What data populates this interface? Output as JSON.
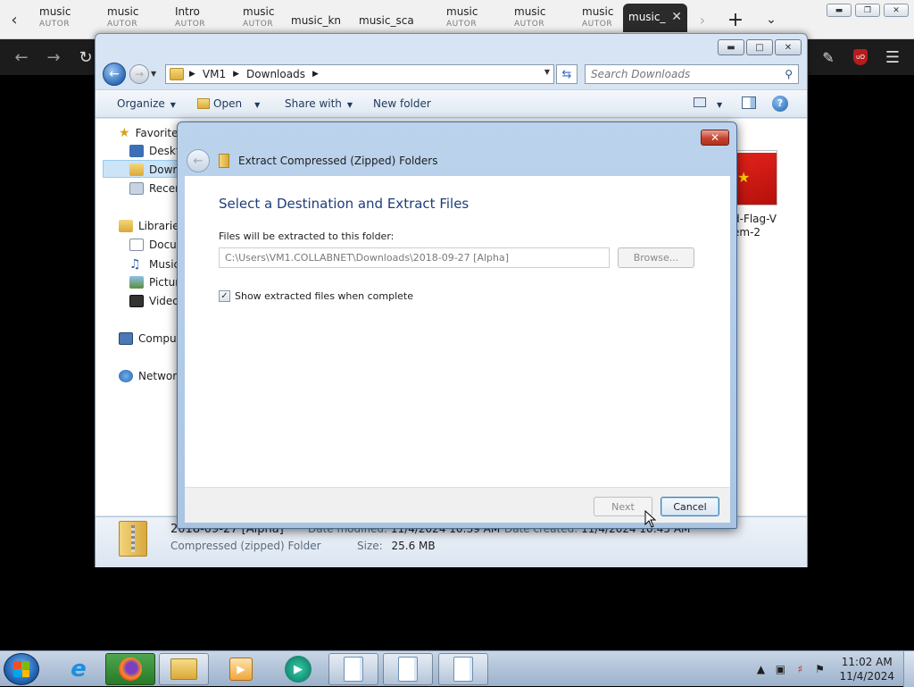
{
  "browser": {
    "tabs": [
      {
        "title": "music",
        "sub": "AUTOR"
      },
      {
        "title": "music",
        "sub": "AUTOR"
      },
      {
        "title": "Intro",
        "sub": "AUTOR"
      },
      {
        "title": "music",
        "sub": "AUTOR"
      },
      {
        "title": "music_kn",
        "sub": ""
      },
      {
        "title": "music_sca",
        "sub": ""
      },
      {
        "title": "music",
        "sub": "AUTOR"
      },
      {
        "title": "music",
        "sub": "AUTOR"
      },
      {
        "title": "music",
        "sub": "AUTOR"
      },
      {
        "title": "music_",
        "sub": ""
      }
    ],
    "active_tab_index": 9
  },
  "explorer": {
    "breadcrumb": [
      "VM1",
      "Downloads"
    ],
    "search_placeholder": "Search Downloads",
    "commands": {
      "organize": "Organize",
      "open": "Open",
      "share_with": "Share with",
      "new_folder": "New folder"
    },
    "nav": {
      "favorites": "Favorites",
      "desktop": "Deskto",
      "downloads": "Downl",
      "recent": "Recen",
      "libraries": "Libraries",
      "documents": "Docun",
      "music": "Music",
      "pictures": "Picture",
      "videos": "Videos",
      "computer": "Comput",
      "network": "Network"
    },
    "file_thumb": {
      "label_line1": "d-Flag-V",
      "label_line2": "em-2"
    },
    "details": {
      "name": "2018-09-27 [Alpha]",
      "type": "Compressed (zipped) Folder",
      "modified_label": "Date modified:",
      "modified_value": "11/4/2024 10:39 AM",
      "created_label": "Date created:",
      "created_value": "11/4/2024 10:45 AM",
      "size_label": "Size:",
      "size_value": "25.6 MB"
    }
  },
  "dialog": {
    "title": "Extract Compressed (Zipped) Folders",
    "heading": "Select a Destination and Extract Files",
    "folder_label": "Files will be extracted to this folder:",
    "path": "C:\\Users\\VM1.COLLABNET\\Downloads\\2018-09-27 [Alpha]",
    "browse": "Browse...",
    "show_checkbox_checked": true,
    "show_label": "Show extracted files when complete",
    "next": "Next",
    "cancel": "Cancel"
  },
  "taskbar": {
    "clock_time": "11:02 AM",
    "clock_date": "11/4/2024"
  },
  "colors": {
    "dialog_heading": "#1e3d7a",
    "taskbar_active": "#277a27",
    "close_red": "#c4432e"
  }
}
